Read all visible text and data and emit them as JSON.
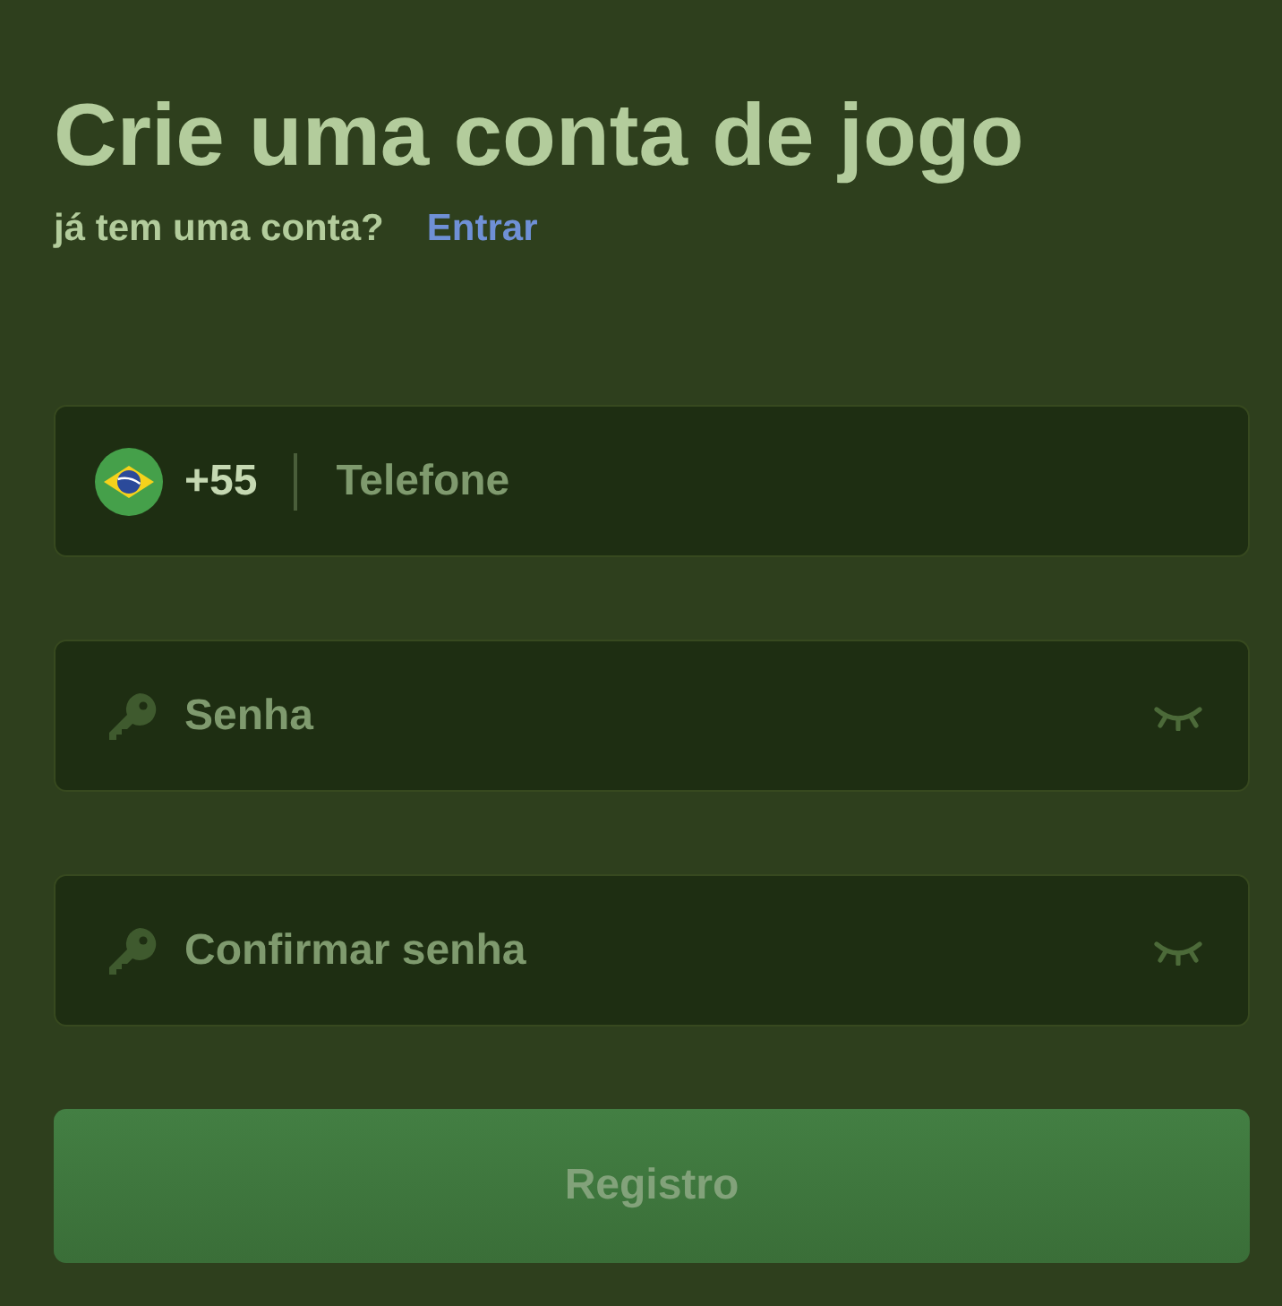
{
  "title": "Crie uma conta de jogo",
  "login_prompt": {
    "text": "já tem uma conta?",
    "link": "Entrar"
  },
  "fields": [
    {
      "kind": "phone",
      "country_code": "+55",
      "placeholder": "Telefone"
    },
    {
      "kind": "password",
      "placeholder": "Senha"
    },
    {
      "kind": "password",
      "placeholder": "Confirmar senha"
    }
  ],
  "submit": {
    "label": "Registro",
    "disabled": true
  }
}
